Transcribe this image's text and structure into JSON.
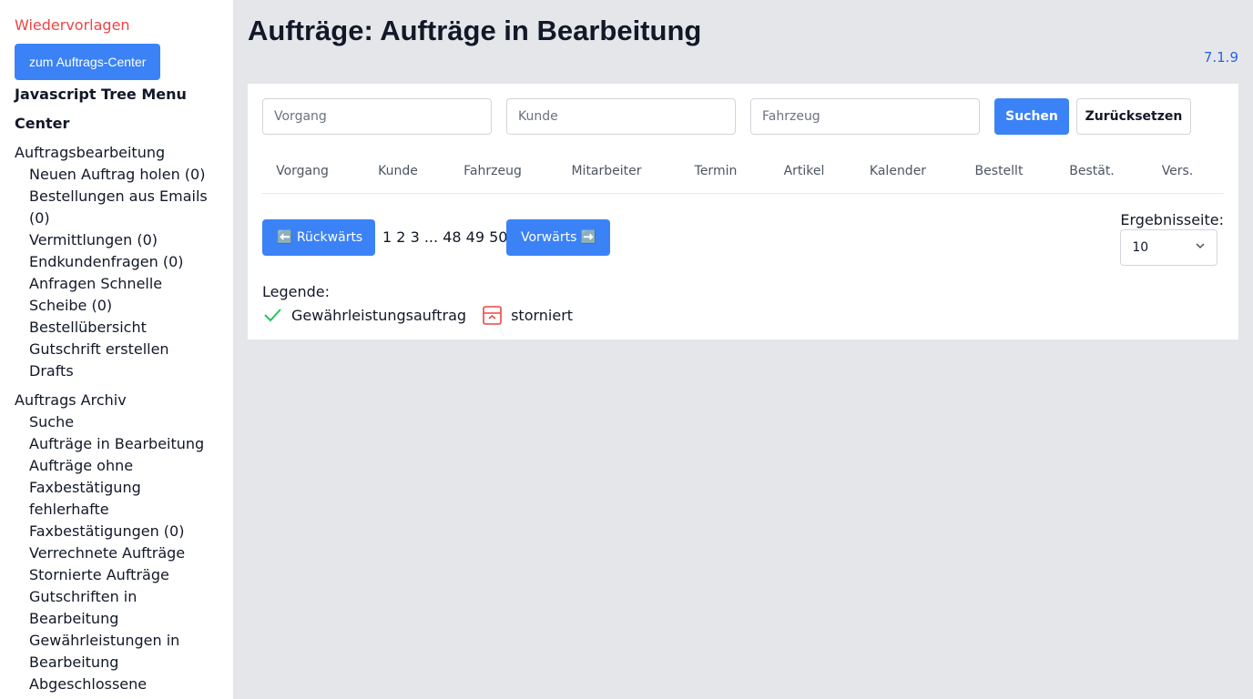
{
  "sidebar": {
    "wiedervorlagen": "Wiedervorlagen",
    "center_button": "zum Auftrags-Center",
    "menu_title": "Javascript Tree Menu",
    "center_title": "Center",
    "groups": [
      {
        "title": "Auftragsbearbeitung",
        "items": [
          "Neuen Auftrag holen (0)",
          "Bestellungen aus Emails (0)",
          "Vermittlungen (0)",
          "Endkundenfragen (0)",
          "Anfragen Schnelle Scheibe (0)",
          "Bestellübersicht",
          "Gutschrift erstellen",
          "Drafts"
        ]
      },
      {
        "title": "Auftrags Archiv",
        "items": [
          "Suche",
          "Aufträge in Bearbeitung",
          "Aufträge ohne Faxbestätigung",
          "fehlerhafte Faxbestätigungen (0)",
          "Verrechnete Aufträge",
          "Stornierte Aufträge",
          "Gutschriften in Bearbeitung",
          "Gewährleistungen in Bearbeitung",
          "Abgeschlossene Gewährleistungen"
        ]
      }
    ]
  },
  "header": {
    "title": "Aufträge: Aufträge in Bearbeitung",
    "version": "7.1.9"
  },
  "search": {
    "vorgang_placeholder": "Vorgang",
    "kunde_placeholder": "Kunde",
    "fahrzeug_placeholder": "Fahrzeug",
    "search_label": "Suchen",
    "reset_label": "Zurücksetzen"
  },
  "table": {
    "columns": [
      "Vorgang",
      "Kunde",
      "Fahrzeug",
      "Mitarbeiter",
      "Termin",
      "Artikel",
      "Kalender",
      "Bestellt",
      "Bestät.",
      "Vers."
    ]
  },
  "pagination": {
    "prev_label": "⬅️ Rückwärts",
    "next_label": "Vorwärts ➡️",
    "pages": [
      "1",
      "2",
      "3",
      "...",
      "48",
      "49",
      "50"
    ]
  },
  "results_per_page": {
    "label": "Ergebnisseite:",
    "value": "10"
  },
  "legend": {
    "title": "Legende:",
    "warranty_label": "Gewährleistungsauftrag",
    "cancelled_label": "storniert"
  },
  "colors": {
    "accent": "#3b82f6",
    "danger": "#ef4444",
    "success": "#22c55e",
    "version": "#2563eb"
  }
}
